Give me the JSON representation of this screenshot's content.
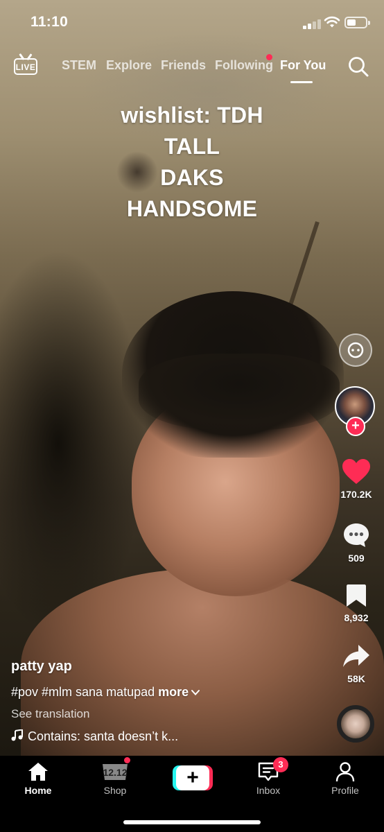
{
  "status_bar": {
    "time": "11:10"
  },
  "top_nav": {
    "live_label": "LIVE",
    "tabs": [
      {
        "label": "STEM",
        "active": false
      },
      {
        "label": "Explore",
        "active": false
      },
      {
        "label": "Friends",
        "active": false
      },
      {
        "label": "Following",
        "active": false,
        "has_dot": true
      },
      {
        "label": "For You",
        "active": true
      }
    ],
    "search_icon": "search-icon"
  },
  "caption": {
    "lines": [
      "wishlist: TDH",
      "TALL",
      "DAKS",
      "HANDSOME"
    ]
  },
  "right_rail": {
    "likes": "170.2K",
    "comments": "509",
    "saves": "8,932",
    "shares": "58K"
  },
  "post": {
    "author": "patty yap",
    "description": "#pov #mlm  sana matupad",
    "more_label": "more",
    "see_translation": "See translation",
    "sound": "Contains: santa doesn’t k..."
  },
  "bottom_nav": {
    "items": [
      {
        "label": "Home",
        "active": true
      },
      {
        "label": "Shop",
        "active": false,
        "badge_text": "12.12"
      },
      {
        "label": "",
        "active": false
      },
      {
        "label": "Inbox",
        "active": false,
        "badge": "3"
      },
      {
        "label": "Profile",
        "active": false
      }
    ]
  },
  "colors": {
    "accent": "#fe2c55",
    "cyan": "#25f4ee"
  }
}
